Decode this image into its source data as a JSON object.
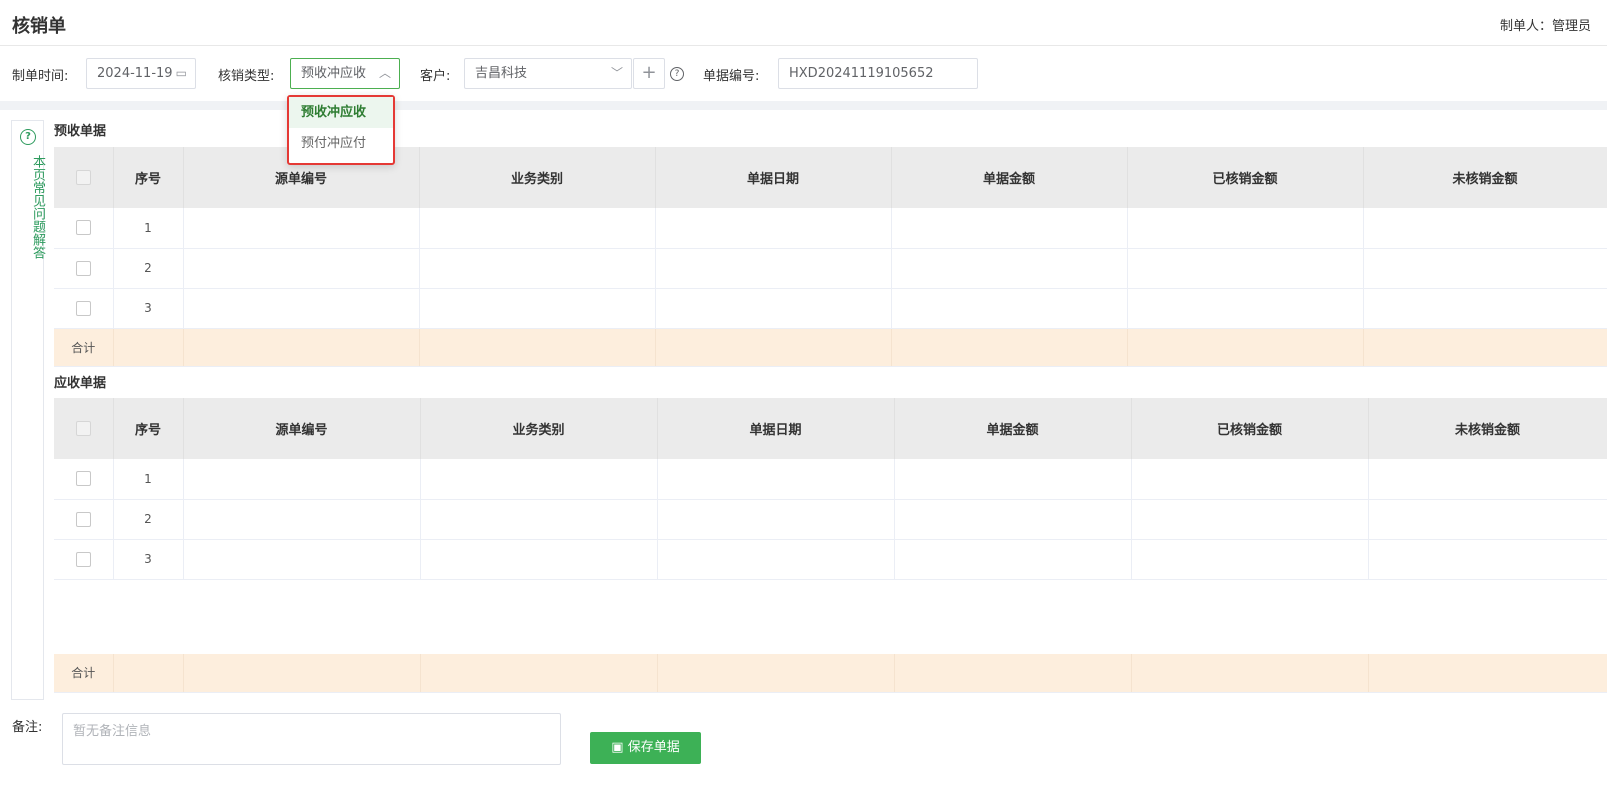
{
  "header": {
    "title": "核销单",
    "creator": "制单人：管理员"
  },
  "filters": {
    "date_label": "制单时间:",
    "date_value": "2024-11-19",
    "type_label": "核销类型:",
    "type_value": "预收冲应收",
    "customer_label": "客户:",
    "customer_value": "吉昌科技",
    "doc_no_label": "单据编号:",
    "doc_no_value": "HXD20241119105652"
  },
  "type_dropdown": {
    "options": [
      "预收冲应收",
      "预付冲应付"
    ],
    "selected": "预收冲应收"
  },
  "faq": {
    "label": "本页常见问题解答"
  },
  "columns": [
    "序号",
    "源单编号",
    "业务类别",
    "单据日期",
    "单据金额",
    "已核销金额",
    "未核销金额"
  ],
  "section1": {
    "title": "预收单据",
    "rows": [
      "1",
      "2",
      "3"
    ],
    "total_label": "合计"
  },
  "section2": {
    "title": "应收单据",
    "rows": [
      "1",
      "2",
      "3"
    ],
    "total_label": "合计"
  },
  "footer": {
    "remark_label": "备注:",
    "remark_placeholder": "暂无备注信息",
    "save_label": "保存单据"
  }
}
